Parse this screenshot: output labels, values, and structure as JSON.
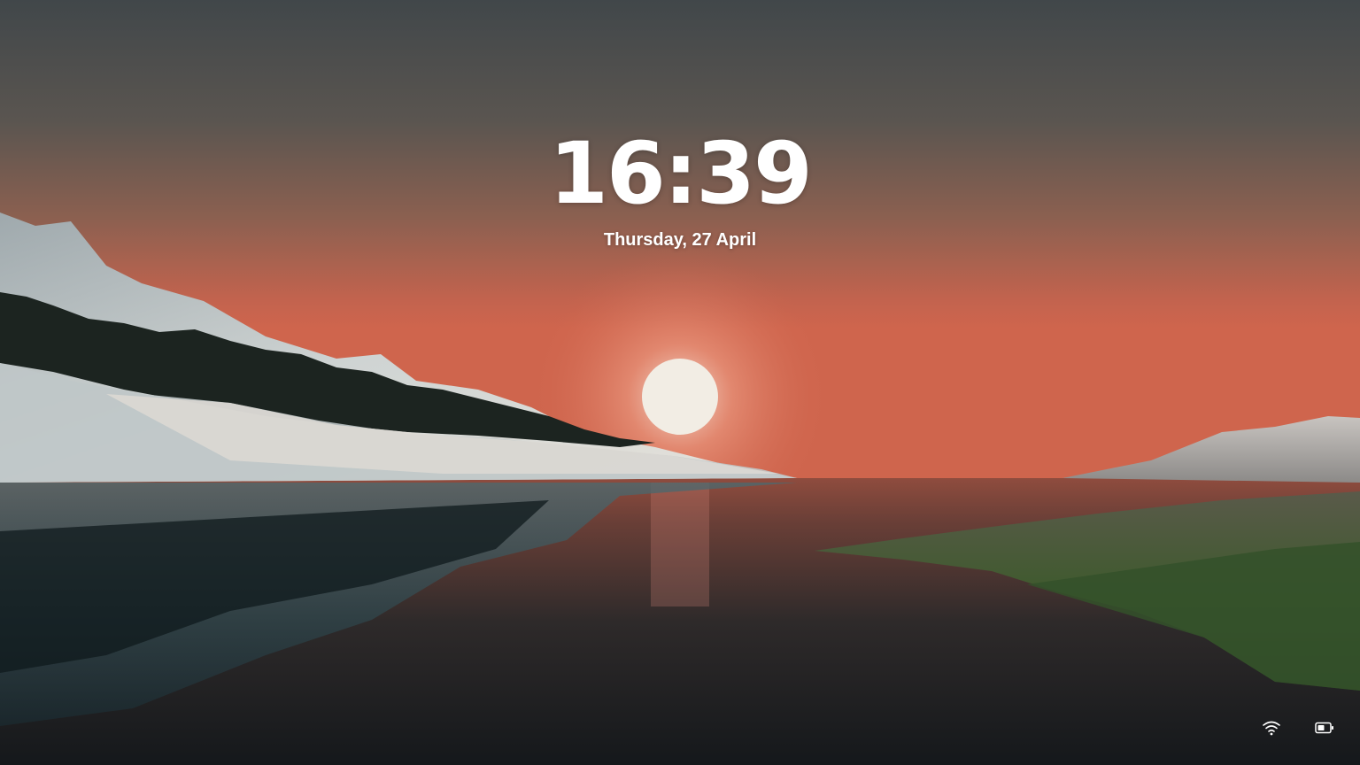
{
  "lockscreen": {
    "time": "16:39",
    "date": "Thursday, 27 April",
    "status_icons": [
      "wifi-icon",
      "battery-icon"
    ]
  },
  "colors": {
    "sky_top": "#44494a",
    "sky_horizon": "#d0644c",
    "sun": "#f2ede4",
    "water_dark": "#1b1f22",
    "grass": "#3f5a2e",
    "snow": "#c9d0d2",
    "text": "#ffffff"
  }
}
